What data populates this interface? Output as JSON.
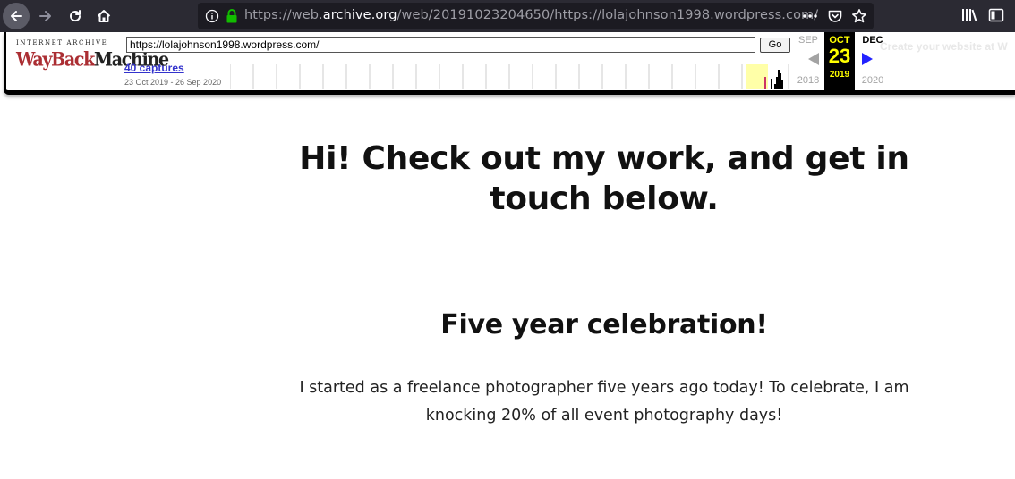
{
  "browser": {
    "url_prefix": "https://web.",
    "url_host": "archive.org",
    "url_suffix": "/web/20191023204650/https://lolajohnson1998.wordpress.com/"
  },
  "wayback": {
    "logo_top": "INTERNET ARCHIVE",
    "logo_main_part1": "WayBack",
    "logo_main_part2": "Machine",
    "url_input_value": "https://lolajohnson1998.wordpress.com/",
    "go_label": "Go",
    "captures_link": "40 captures",
    "date_range": "23 Oct 2019 - 26 Sep 2020",
    "prev_month": "SEP",
    "prev_year": "2018",
    "current_month": "OCT",
    "current_day": "23",
    "current_year": "2019",
    "next_month": "DEC",
    "next_year": "2020",
    "promo_text": "Create your website at W",
    "accent_color": "#ffff00",
    "link_color": "#3333cc"
  },
  "page": {
    "hero_title": "Hi! Check out my work, and get in touch below.",
    "section_title": "Five year celebration!",
    "section_text": "I started as a freelance photographer five years ago today! To celebrate, I am knocking 20% of all event photography days!"
  }
}
